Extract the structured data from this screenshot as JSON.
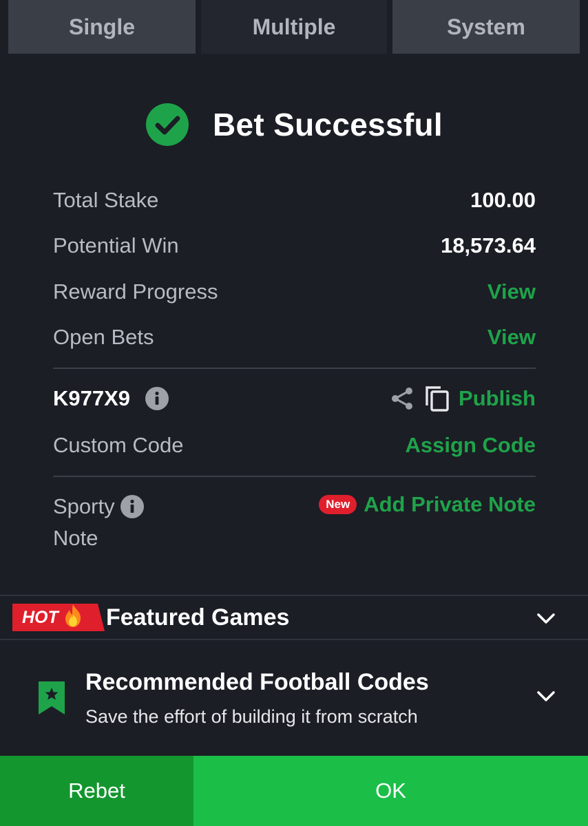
{
  "tabs": [
    {
      "label": "Single",
      "active": false
    },
    {
      "label": "Multiple",
      "active": true
    },
    {
      "label": "System",
      "active": false
    }
  ],
  "header": {
    "title": "Bet Successful",
    "icon": "check-circle-icon"
  },
  "summary": {
    "total_stake_label": "Total Stake",
    "total_stake_value": "100.00",
    "potential_win_label": "Potential Win",
    "potential_win_value": "18,573.64",
    "reward_progress_label": "Reward Progress",
    "reward_progress_link": "View",
    "open_bets_label": "Open Bets",
    "open_bets_link": "View"
  },
  "booking": {
    "code": "K977X9",
    "publish_label": "Publish",
    "custom_code_label": "Custom Code",
    "assign_code_label": "Assign Code"
  },
  "note": {
    "label": "Sporty Note",
    "new_badge": "New",
    "add_note_label": "Add Private Note"
  },
  "featured": {
    "hot_badge": "HOT",
    "title": "Featured Games"
  },
  "recommended": {
    "title": "Recommended Football Codes",
    "subtitle": "Save the effort of building it from scratch"
  },
  "actions": {
    "rebet_label": "Rebet",
    "ok_label": "OK"
  },
  "colors": {
    "background": "#1b1e25",
    "accent_green": "#1fa34a",
    "ok_button": "#1bbf48",
    "rebet_button": "#14962f",
    "badge_red": "#e01f2c"
  }
}
